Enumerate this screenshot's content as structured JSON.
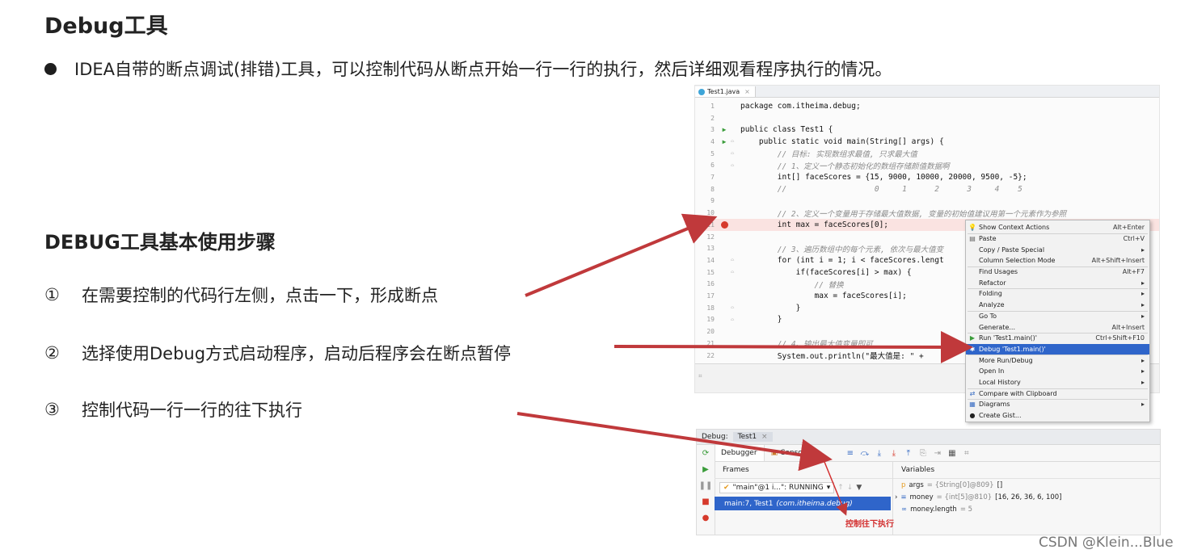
{
  "heading": "Debug工具",
  "intro": "IDEA自带的断点调试(排错)工具，可以控制代码从断点开始一行一行的执行，然后详细观看程序执行的情况。",
  "subheading": "DEBUG工具基本使用步骤",
  "steps": [
    {
      "num": "①",
      "text": "在需要控制的代码行左侧，点击一下，形成断点"
    },
    {
      "num": "②",
      "text": "选择使用Debug方式启动程序，启动后程序会在断点暂停"
    },
    {
      "num": "③",
      "text": "控制代码一行一行的往下执行"
    }
  ],
  "editor": {
    "tab": "Test1.java",
    "tab_close": "×",
    "lines": [
      {
        "n": "1",
        "code": "package com.itheima.debug;"
      },
      {
        "n": "2",
        "code": ""
      },
      {
        "n": "3",
        "code": "public class Test1 {"
      },
      {
        "n": "4",
        "code": "    public static void main(String[] args) {"
      },
      {
        "n": "5",
        "code": "        // 目标: 实现数组求最值, 只求最大值"
      },
      {
        "n": "6",
        "code": "        // 1、定义一个静态初始化的数组存储颜值数据啊"
      },
      {
        "n": "7",
        "code": "        int[] faceScores = {15, 9000, 10000, 20000, 9500, -5};"
      },
      {
        "n": "8",
        "code": "        //                   0     1      2      3     4    5"
      },
      {
        "n": "9",
        "code": ""
      },
      {
        "n": "10",
        "code": "        // 2、定义一个变量用于存储最大值数据, 变量的初始值建议用第一个元素作为参照"
      },
      {
        "n": "11",
        "code": "        int max = faceScores[0];"
      },
      {
        "n": "12",
        "code": ""
      },
      {
        "n": "13",
        "code": "        // 3、遍历数组中的每个元素, 依次与最大值变"
      },
      {
        "n": "14",
        "code": "        for (int i = 1; i < faceScores.lengt"
      },
      {
        "n": "15",
        "code": "            if(faceScores[i] > max) {"
      },
      {
        "n": "16",
        "code": "                // 替换"
      },
      {
        "n": "17",
        "code": "                max = faceScores[i];"
      },
      {
        "n": "18",
        "code": "            }"
      },
      {
        "n": "19",
        "code": "        }"
      },
      {
        "n": "20",
        "code": ""
      },
      {
        "n": "21",
        "code": "        // 4、输出最大值变量即可"
      },
      {
        "n": "22",
        "code": "        System.out.println(\"最大值是: \" + "
      }
    ],
    "footer_label": "⌗"
  },
  "context_menu": {
    "items": [
      {
        "label": "Show Context Actions",
        "shortcut": "Alt+Enter",
        "icon": "lightbulb-icon"
      },
      {
        "label": "Paste",
        "shortcut": "Ctrl+V",
        "icon": "paste-icon"
      },
      {
        "label": "Copy / Paste Special",
        "shortcut": "▸",
        "icon": ""
      },
      {
        "label": "Column Selection Mode",
        "shortcut": "Alt+Shift+Insert",
        "icon": ""
      },
      {
        "label": "Find Usages",
        "shortcut": "Alt+F7",
        "icon": ""
      },
      {
        "label": "Refactor",
        "shortcut": "▸",
        "icon": ""
      },
      {
        "label": "Folding",
        "shortcut": "▸",
        "icon": ""
      },
      {
        "label": "Analyze",
        "shortcut": "▸",
        "icon": ""
      },
      {
        "label": "Go To",
        "shortcut": "▸",
        "icon": ""
      },
      {
        "label": "Generate...",
        "shortcut": "Alt+Insert",
        "icon": ""
      },
      {
        "label": "Run 'Test1.main()'",
        "shortcut": "Ctrl+Shift+F10",
        "icon": "run-icon"
      },
      {
        "label": "Debug 'Test1.main()'",
        "shortcut": "",
        "icon": "debug-icon"
      },
      {
        "label": "More Run/Debug",
        "shortcut": "▸",
        "icon": ""
      },
      {
        "label": "Open In",
        "shortcut": "▸",
        "icon": ""
      },
      {
        "label": "Local History",
        "shortcut": "▸",
        "icon": ""
      },
      {
        "label": "Compare with Clipboard",
        "shortcut": "",
        "icon": "compare-icon"
      },
      {
        "label": "Diagrams",
        "shortcut": "▸",
        "icon": "diagram-icon"
      },
      {
        "label": "Create Gist...",
        "shortcut": "",
        "icon": "github-icon"
      }
    ]
  },
  "debug": {
    "title": "Debug:",
    "session_tab": "Test1",
    "session_close": "×",
    "tab_debugger": "Debugger",
    "tab_console": "Console",
    "frames_label": "Frames",
    "variables_label": "Variables",
    "thread": "\"main\"@1 i...\": RUNNING",
    "frame": "main:7, Test1",
    "frame_pkg": "(com.itheima.debug)",
    "vars": [
      {
        "name": "args",
        "type": "= {String[0]@809}",
        "value": "[]",
        "icon": "p"
      },
      {
        "name": "money",
        "type": "= {int[5]@810}",
        "value": "[16, 26, 36, 6, 100]",
        "icon": "≡"
      },
      {
        "name": "money.length",
        "type": "= 5",
        "value": "",
        "icon": "∞"
      }
    ]
  },
  "annotation": "控制往下执行",
  "watermark": "CSDN @Klein...Blue",
  "colors": {
    "accent": "#2f65ca",
    "arrow": "#c0393b",
    "breakpoint": "#d63a2c"
  }
}
